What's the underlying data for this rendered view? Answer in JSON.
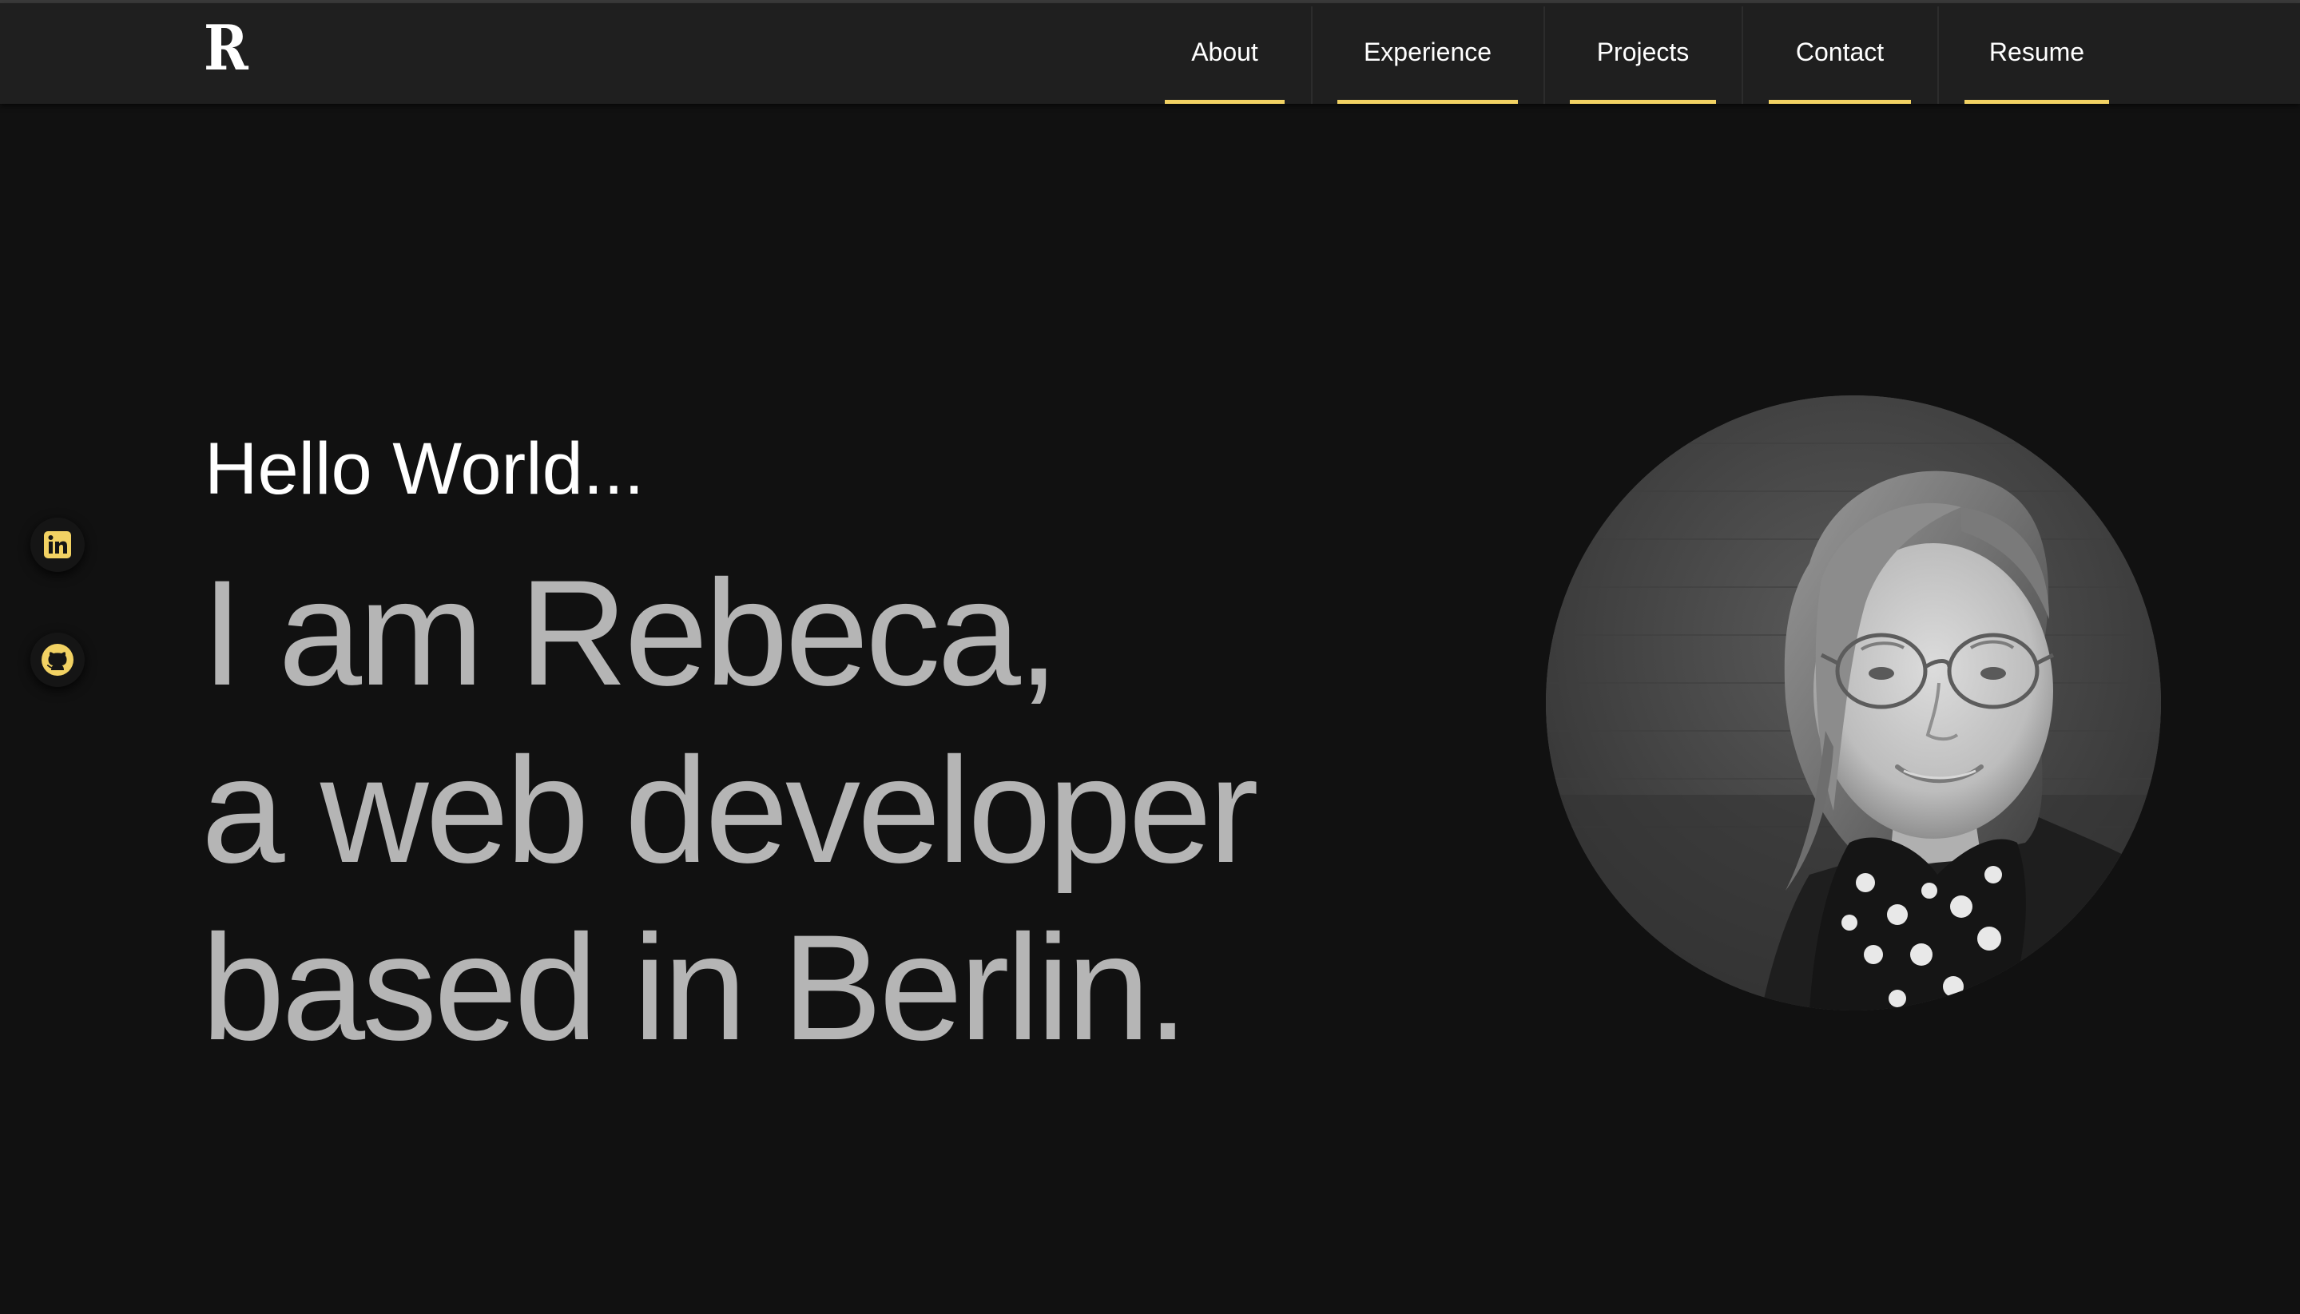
{
  "logo": {
    "text": "R"
  },
  "nav": {
    "items": [
      {
        "label": "About"
      },
      {
        "label": "Experience"
      },
      {
        "label": "Projects"
      },
      {
        "label": "Contact"
      },
      {
        "label": "Resume"
      }
    ],
    "accent_color": "#f2d263"
  },
  "social": {
    "items": [
      {
        "icon": "linkedin-icon"
      },
      {
        "icon": "github-icon"
      }
    ],
    "icon_color": "#f2d263"
  },
  "hero": {
    "greeting": "Hello World...",
    "lines": [
      "I am Rebeca,",
      "a web developer",
      "based in Berlin."
    ]
  },
  "profile_photo": {
    "style": "grayscale-circle"
  },
  "colors": {
    "background": "#111111",
    "navbar": "#1f1f1f",
    "headline": "#b5b5b5",
    "greeting": "#ffffff"
  }
}
